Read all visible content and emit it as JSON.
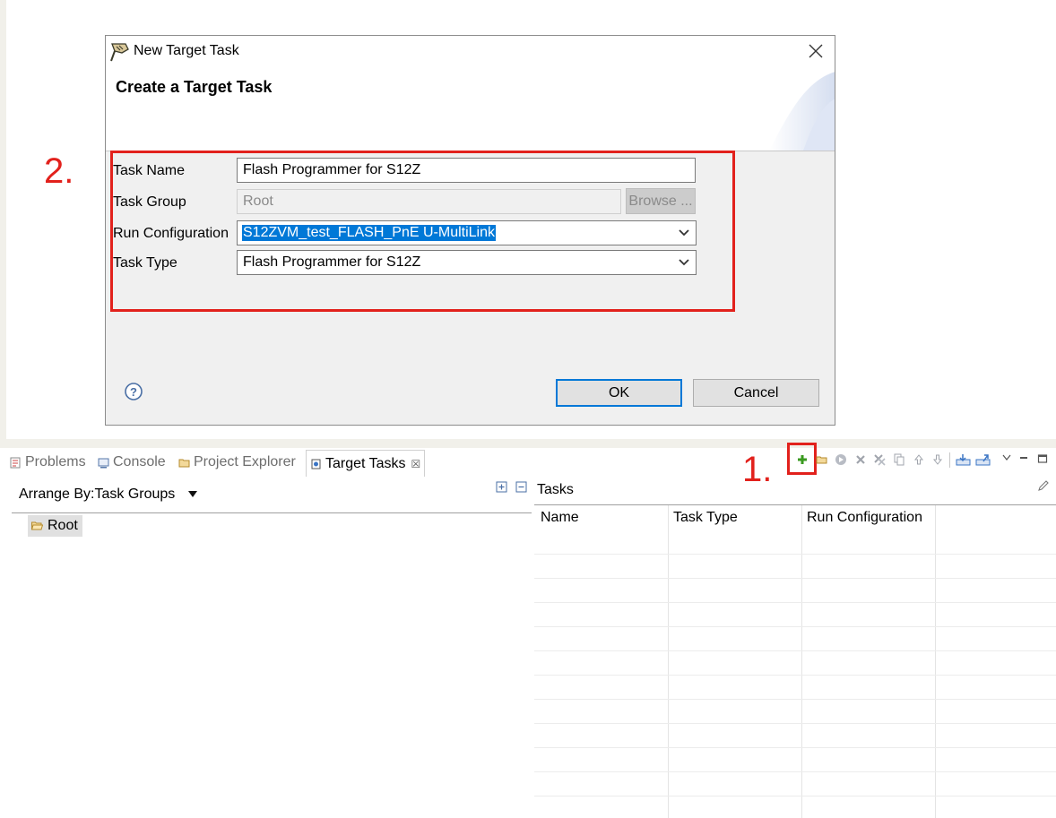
{
  "dialog": {
    "title": "New Target Task",
    "heading": "Create a Target Task",
    "task_name_label": "Task Name",
    "task_name_value": "Flash Programmer for S12Z",
    "task_group_label": "Task Group",
    "task_group_value": "Root",
    "browse_label": "Browse ...",
    "run_config_label": "Run Configuration",
    "run_config_value": "S12ZVM_test_FLASH_PnE U-MultiLink",
    "task_type_label": "Task Type",
    "task_type_value": "Flash Programmer for S12Z",
    "ok_label": "OK",
    "cancel_label": "Cancel"
  },
  "annotations": {
    "step1": "1.",
    "step2": "2."
  },
  "views": {
    "tabs": [
      {
        "label": "Problems",
        "icon": "problems-icon"
      },
      {
        "label": "Console",
        "icon": "console-icon"
      },
      {
        "label": "Project Explorer",
        "icon": "project-explorer-icon"
      },
      {
        "label": "Target Tasks",
        "icon": "target-tasks-icon",
        "active": true
      }
    ],
    "close_glyph": "☒"
  },
  "left_panel": {
    "arrange_label": "Arrange By:Task Groups",
    "root_label": "Root"
  },
  "tasks_panel": {
    "title": "Tasks",
    "columns": [
      "Name",
      "Task Type",
      "Run Configuration"
    ]
  },
  "colors": {
    "annotation_red": "#e2211c",
    "selection_blue": "#0078d7",
    "add_green": "#3a9a1f"
  }
}
